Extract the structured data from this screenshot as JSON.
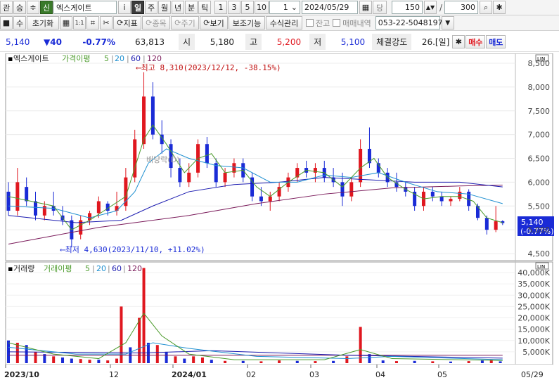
{
  "toolbar1": {
    "tab_kwan": "관",
    "tab_sung": "승",
    "stepper": "≑",
    "stock_prefix": "신",
    "stock_name": "엑스게이트",
    "info_btn": "i",
    "periods": [
      "일",
      "주",
      "월",
      "년",
      "분",
      "틱"
    ],
    "minutes": [
      "1",
      "3",
      "5",
      "10"
    ],
    "interval_value": "1",
    "date": "2024/05/29",
    "date_mode": "당",
    "count_value": "150",
    "slash": "/",
    "total_value": "300"
  },
  "toolbar2": {
    "su": "수",
    "reset": "초기화",
    "mode_1to1": "1:1",
    "indicator": "지표",
    "item": "종목",
    "period": "주기",
    "view": "보기",
    "aux": "보조기능",
    "formula": "수식관리",
    "balance": "잔고",
    "trade_history": "매매내역",
    "phone": "053-22-5048197"
  },
  "quote": {
    "price": "5,140",
    "change": "▼40",
    "change_rate": "-0.77%",
    "volume": "63,813",
    "open_label": "시",
    "open": "5,180",
    "high_label": "고",
    "high": "5,200",
    "low_label": "저",
    "low": "5,100",
    "strength_label": "체결강도",
    "strength": "26.[일]",
    "buy": "매수",
    "sell": "매도"
  },
  "price_panel": {
    "legend_name": "엑스게이트",
    "legend_ma": "가격이평",
    "ma_periods": [
      "5",
      "20",
      "60",
      "120"
    ],
    "high_annotation": "최고 8,310(2023/12/12, -38.15%)",
    "low_annotation": "최저 4,630(2023/11/10, +11.02%)",
    "watermark": "배당락(D)",
    "current_price_tag": "5,140",
    "current_rate_tag": "(-0.77%)",
    "y_ticks": [
      "8,500",
      "8,000",
      "7,500",
      "7,000",
      "6,500",
      "6,000",
      "5,500",
      "5,000",
      "4,500"
    ],
    "scale_label": "LIN"
  },
  "volume_panel": {
    "legend_name": "거래량",
    "legend_ma": "거래이평",
    "ma_periods": [
      "5",
      "20",
      "60",
      "120"
    ],
    "y_ticks": [
      "40,000K",
      "35,000K",
      "30,000K",
      "25,000K",
      "20,000K",
      "15,000K",
      "10,000K",
      "5,000K"
    ],
    "scale_label": "LIN"
  },
  "x_axis": {
    "labels": [
      "2023/10",
      "12",
      "2024/01",
      "02",
      "03",
      "04",
      "05"
    ],
    "end_label": "05/29"
  },
  "colors": {
    "up": "#e0171f",
    "down": "#1a2bd6",
    "ma5": "#4a9a2a",
    "ma20": "#1e8fd0",
    "ma60": "#1b1bb0",
    "ma120": "#7a1a5a",
    "tag": "#1a2bd6"
  },
  "chart_data": {
    "type": "candlestick",
    "price_ylim": [
      4500,
      8500
    ],
    "volume_ylim_k": [
      0,
      40000
    ],
    "candles": [
      {
        "i": 0,
        "o": 5800,
        "h": 6000,
        "l": 5300,
        "c": 5400
      },
      {
        "i": 4,
        "o": 5400,
        "h": 6300,
        "l": 5300,
        "c": 6000
      },
      {
        "i": 8,
        "o": 5900,
        "h": 6100,
        "l": 5500,
        "c": 5600
      },
      {
        "i": 12,
        "o": 5600,
        "h": 5800,
        "l": 5200,
        "c": 5300
      },
      {
        "i": 16,
        "o": 5300,
        "h": 5600,
        "l": 5200,
        "c": 5500
      },
      {
        "i": 20,
        "o": 5500,
        "h": 5800,
        "l": 5300,
        "c": 5400
      },
      {
        "i": 24,
        "o": 5300,
        "h": 5500,
        "l": 5100,
        "c": 5200
      },
      {
        "i": 28,
        "o": 5200,
        "h": 5300,
        "l": 4630,
        "c": 4800
      },
      {
        "i": 32,
        "o": 4900,
        "h": 5300,
        "l": 4800,
        "c": 5200
      },
      {
        "i": 36,
        "o": 5200,
        "h": 5400,
        "l": 5100,
        "c": 5350
      },
      {
        "i": 40,
        "o": 5350,
        "h": 5700,
        "l": 5250,
        "c": 5600
      },
      {
        "i": 44,
        "o": 5550,
        "h": 5600,
        "l": 5300,
        "c": 5400
      },
      {
        "i": 48,
        "o": 5400,
        "h": 5800,
        "l": 5300,
        "c": 5500
      },
      {
        "i": 52,
        "o": 5500,
        "h": 6300,
        "l": 5400,
        "c": 6100
      },
      {
        "i": 56,
        "o": 6100,
        "h": 7100,
        "l": 6000,
        "c": 6900
      },
      {
        "i": 60,
        "o": 6800,
        "h": 8310,
        "l": 6700,
        "c": 7800
      },
      {
        "i": 64,
        "o": 7800,
        "h": 8100,
        "l": 6900,
        "c": 7000
      },
      {
        "i": 68,
        "o": 7000,
        "h": 7300,
        "l": 6600,
        "c": 6800
      },
      {
        "i": 72,
        "o": 6800,
        "h": 6900,
        "l": 6100,
        "c": 6300
      },
      {
        "i": 76,
        "o": 6300,
        "h": 6500,
        "l": 5900,
        "c": 6000
      },
      {
        "i": 80,
        "o": 6000,
        "h": 6400,
        "l": 5900,
        "c": 6200
      },
      {
        "i": 84,
        "o": 6200,
        "h": 6900,
        "l": 6100,
        "c": 6800
      },
      {
        "i": 88,
        "o": 6800,
        "h": 6950,
        "l": 6300,
        "c": 6400
      },
      {
        "i": 92,
        "o": 6400,
        "h": 6500,
        "l": 5900,
        "c": 6000
      },
      {
        "i": 96,
        "o": 6000,
        "h": 6300,
        "l": 5900,
        "c": 6200
      },
      {
        "i": 100,
        "o": 6200,
        "h": 6500,
        "l": 6100,
        "c": 6400
      },
      {
        "i": 104,
        "o": 6400,
        "h": 6500,
        "l": 6000,
        "c": 6100
      },
      {
        "i": 108,
        "o": 6100,
        "h": 6200,
        "l": 5600,
        "c": 5700
      },
      {
        "i": 112,
        "o": 5700,
        "h": 5900,
        "l": 5500,
        "c": 5600
      },
      {
        "i": 116,
        "o": 5600,
        "h": 5800,
        "l": 5400,
        "c": 5700
      },
      {
        "i": 120,
        "o": 5700,
        "h": 6000,
        "l": 5600,
        "c": 5900
      },
      {
        "i": 124,
        "o": 5900,
        "h": 6200,
        "l": 5800,
        "c": 6100
      },
      {
        "i": 128,
        "o": 6100,
        "h": 6400,
        "l": 6000,
        "c": 6300
      },
      {
        "i": 132,
        "o": 6300,
        "h": 6450,
        "l": 6100,
        "c": 6200
      },
      {
        "i": 136,
        "o": 6200,
        "h": 6400,
        "l": 6000,
        "c": 6300
      },
      {
        "i": 140,
        "o": 6300,
        "h": 6450,
        "l": 6000,
        "c": 6100
      },
      {
        "i": 144,
        "o": 6100,
        "h": 6300,
        "l": 5900,
        "c": 6000
      },
      {
        "i": 148,
        "o": 6000,
        "h": 6200,
        "l": 5500,
        "c": 5700
      },
      {
        "i": 152,
        "o": 5700,
        "h": 6100,
        "l": 5600,
        "c": 6000
      },
      {
        "i": 156,
        "o": 6000,
        "h": 6900,
        "l": 5900,
        "c": 6700
      },
      {
        "i": 160,
        "o": 6700,
        "h": 7150,
        "l": 6300,
        "c": 6400
      },
      {
        "i": 164,
        "o": 6400,
        "h": 6500,
        "l": 6100,
        "c": 6200
      },
      {
        "i": 168,
        "o": 6200,
        "h": 6300,
        "l": 5900,
        "c": 6000
      },
      {
        "i": 172,
        "o": 6000,
        "h": 6200,
        "l": 5800,
        "c": 5900
      },
      {
        "i": 176,
        "o": 5900,
        "h": 6000,
        "l": 5700,
        "c": 5800
      },
      {
        "i": 180,
        "o": 5800,
        "h": 5900,
        "l": 5400,
        "c": 5500
      },
      {
        "i": 184,
        "o": 5500,
        "h": 5900,
        "l": 5400,
        "c": 5800
      },
      {
        "i": 188,
        "o": 5800,
        "h": 5900,
        "l": 5600,
        "c": 5700
      },
      {
        "i": 192,
        "o": 5700,
        "h": 5800,
        "l": 5500,
        "c": 5600
      },
      {
        "i": 196,
        "o": 5600,
        "h": 5700,
        "l": 5500,
        "c": 5650
      },
      {
        "i": 200,
        "o": 5650,
        "h": 5900,
        "l": 5600,
        "c": 5800
      },
      {
        "i": 204,
        "o": 5800,
        "h": 5850,
        "l": 5400,
        "c": 5500
      },
      {
        "i": 208,
        "o": 5500,
        "h": 5550,
        "l": 5200,
        "c": 5250
      },
      {
        "i": 212,
        "o": 5250,
        "h": 5300,
        "l": 4900,
        "c": 5000
      },
      {
        "i": 216,
        "o": 5000,
        "h": 5500,
        "l": 4950,
        "c": 5180
      },
      {
        "i": 219,
        "o": 5180,
        "h": 5200,
        "l": 5100,
        "c": 5140
      }
    ],
    "volumes_k": [
      {
        "i": 0,
        "v": 10000,
        "up": false
      },
      {
        "i": 4,
        "v": 9000,
        "up": true
      },
      {
        "i": 8,
        "v": 8000,
        "up": false
      },
      {
        "i": 12,
        "v": 5000,
        "up": true
      },
      {
        "i": 16,
        "v": 4000,
        "up": false
      },
      {
        "i": 20,
        "v": 3000,
        "up": true
      },
      {
        "i": 24,
        "v": 2500,
        "up": false
      },
      {
        "i": 28,
        "v": 2000,
        "up": false
      },
      {
        "i": 32,
        "v": 1800,
        "up": true
      },
      {
        "i": 36,
        "v": 1500,
        "up": true
      },
      {
        "i": 40,
        "v": 1500,
        "up": false
      },
      {
        "i": 44,
        "v": 1200,
        "up": true
      },
      {
        "i": 48,
        "v": 2000,
        "up": true
      },
      {
        "i": 50,
        "v": 25000,
        "up": true
      },
      {
        "i": 54,
        "v": 7000,
        "up": false
      },
      {
        "i": 58,
        "v": 20000,
        "up": true
      },
      {
        "i": 60,
        "v": 42000,
        "up": true
      },
      {
        "i": 62,
        "v": 9000,
        "up": false
      },
      {
        "i": 66,
        "v": 8000,
        "up": true
      },
      {
        "i": 70,
        "v": 5000,
        "up": false
      },
      {
        "i": 74,
        "v": 3000,
        "up": true
      },
      {
        "i": 78,
        "v": 2000,
        "up": false
      },
      {
        "i": 82,
        "v": 3000,
        "up": true
      },
      {
        "i": 86,
        "v": 2500,
        "up": true
      },
      {
        "i": 90,
        "v": 1500,
        "up": false
      },
      {
        "i": 96,
        "v": 1000,
        "up": true
      },
      {
        "i": 104,
        "v": 1000,
        "up": false
      },
      {
        "i": 112,
        "v": 800,
        "up": true
      },
      {
        "i": 120,
        "v": 1200,
        "up": true
      },
      {
        "i": 128,
        "v": 1000,
        "up": false
      },
      {
        "i": 136,
        "v": 900,
        "up": true
      },
      {
        "i": 144,
        "v": 1000,
        "up": false
      },
      {
        "i": 150,
        "v": 3000,
        "up": true
      },
      {
        "i": 156,
        "v": 16000,
        "up": true
      },
      {
        "i": 160,
        "v": 4000,
        "up": false
      },
      {
        "i": 166,
        "v": 1200,
        "up": false
      },
      {
        "i": 172,
        "v": 900,
        "up": true
      },
      {
        "i": 180,
        "v": 1000,
        "up": false
      },
      {
        "i": 188,
        "v": 800,
        "up": true
      },
      {
        "i": 196,
        "v": 700,
        "up": false
      },
      {
        "i": 204,
        "v": 900,
        "up": true
      },
      {
        "i": 210,
        "v": 1200,
        "up": false
      },
      {
        "i": 214,
        "v": 1500,
        "up": true
      },
      {
        "i": 218,
        "v": 800,
        "up": false
      }
    ],
    "ma5": [
      [
        0,
        5700
      ],
      [
        10,
        5600
      ],
      [
        20,
        5500
      ],
      [
        28,
        5000
      ],
      [
        36,
        5200
      ],
      [
        44,
        5450
      ],
      [
        52,
        5700
      ],
      [
        56,
        6300
      ],
      [
        60,
        6900
      ],
      [
        64,
        7200
      ],
      [
        70,
        6800
      ],
      [
        78,
        6200
      ],
      [
        84,
        6500
      ],
      [
        90,
        6600
      ],
      [
        96,
        6200
      ],
      [
        104,
        6250
      ],
      [
        110,
        5900
      ],
      [
        116,
        5700
      ],
      [
        124,
        6000
      ],
      [
        132,
        6250
      ],
      [
        140,
        6200
      ],
      [
        148,
        5900
      ],
      [
        156,
        6300
      ],
      [
        162,
        6500
      ],
      [
        168,
        6100
      ],
      [
        176,
        5850
      ],
      [
        184,
        5650
      ],
      [
        192,
        5700
      ],
      [
        200,
        5700
      ],
      [
        206,
        5600
      ],
      [
        212,
        5250
      ],
      [
        219,
        5150
      ]
    ],
    "ma20": [
      [
        0,
        5500
      ],
      [
        20,
        5450
      ],
      [
        36,
        5250
      ],
      [
        48,
        5400
      ],
      [
        56,
        5800
      ],
      [
        62,
        6400
      ],
      [
        70,
        6700
      ],
      [
        80,
        6500
      ],
      [
        92,
        6350
      ],
      [
        104,
        6300
      ],
      [
        116,
        6000
      ],
      [
        128,
        6000
      ],
      [
        140,
        6150
      ],
      [
        152,
        6100
      ],
      [
        164,
        6200
      ],
      [
        176,
        6000
      ],
      [
        190,
        5800
      ],
      [
        204,
        5750
      ],
      [
        219,
        5550
      ]
    ],
    "ma60": [
      [
        0,
        5300
      ],
      [
        30,
        5150
      ],
      [
        50,
        5200
      ],
      [
        64,
        5500
      ],
      [
        80,
        5800
      ],
      [
        100,
        5950
      ],
      [
        120,
        6000
      ],
      [
        140,
        6100
      ],
      [
        160,
        6050
      ],
      [
        180,
        6000
      ],
      [
        200,
        6000
      ],
      [
        219,
        5900
      ]
    ],
    "ma120": [
      [
        0,
        4700
      ],
      [
        40,
        5050
      ],
      [
        80,
        5300
      ],
      [
        110,
        5550
      ],
      [
        140,
        5750
      ],
      [
        170,
        5880
      ],
      [
        200,
        5920
      ],
      [
        219,
        5940
      ]
    ],
    "vol_ma5": [
      [
        0,
        9000
      ],
      [
        20,
        4000
      ],
      [
        40,
        2000
      ],
      [
        52,
        9000
      ],
      [
        60,
        22000
      ],
      [
        68,
        12000
      ],
      [
        80,
        4000
      ],
      [
        100,
        1500
      ],
      [
        140,
        1500
      ],
      [
        156,
        6000
      ],
      [
        170,
        2000
      ],
      [
        219,
        1200
      ]
    ],
    "vol_ma20": [
      [
        0,
        7000
      ],
      [
        30,
        4000
      ],
      [
        52,
        4000
      ],
      [
        64,
        9000
      ],
      [
        80,
        6500
      ],
      [
        110,
        3000
      ],
      [
        150,
        2000
      ],
      [
        170,
        3000
      ],
      [
        219,
        1500
      ]
    ],
    "vol_ma60": [
      [
        0,
        5000
      ],
      [
        60,
        4500
      ],
      [
        90,
        5500
      ],
      [
        150,
        3500
      ],
      [
        219,
        2200
      ]
    ],
    "vol_ma120": [
      [
        0,
        3500
      ],
      [
        219,
        3500
      ]
    ]
  }
}
